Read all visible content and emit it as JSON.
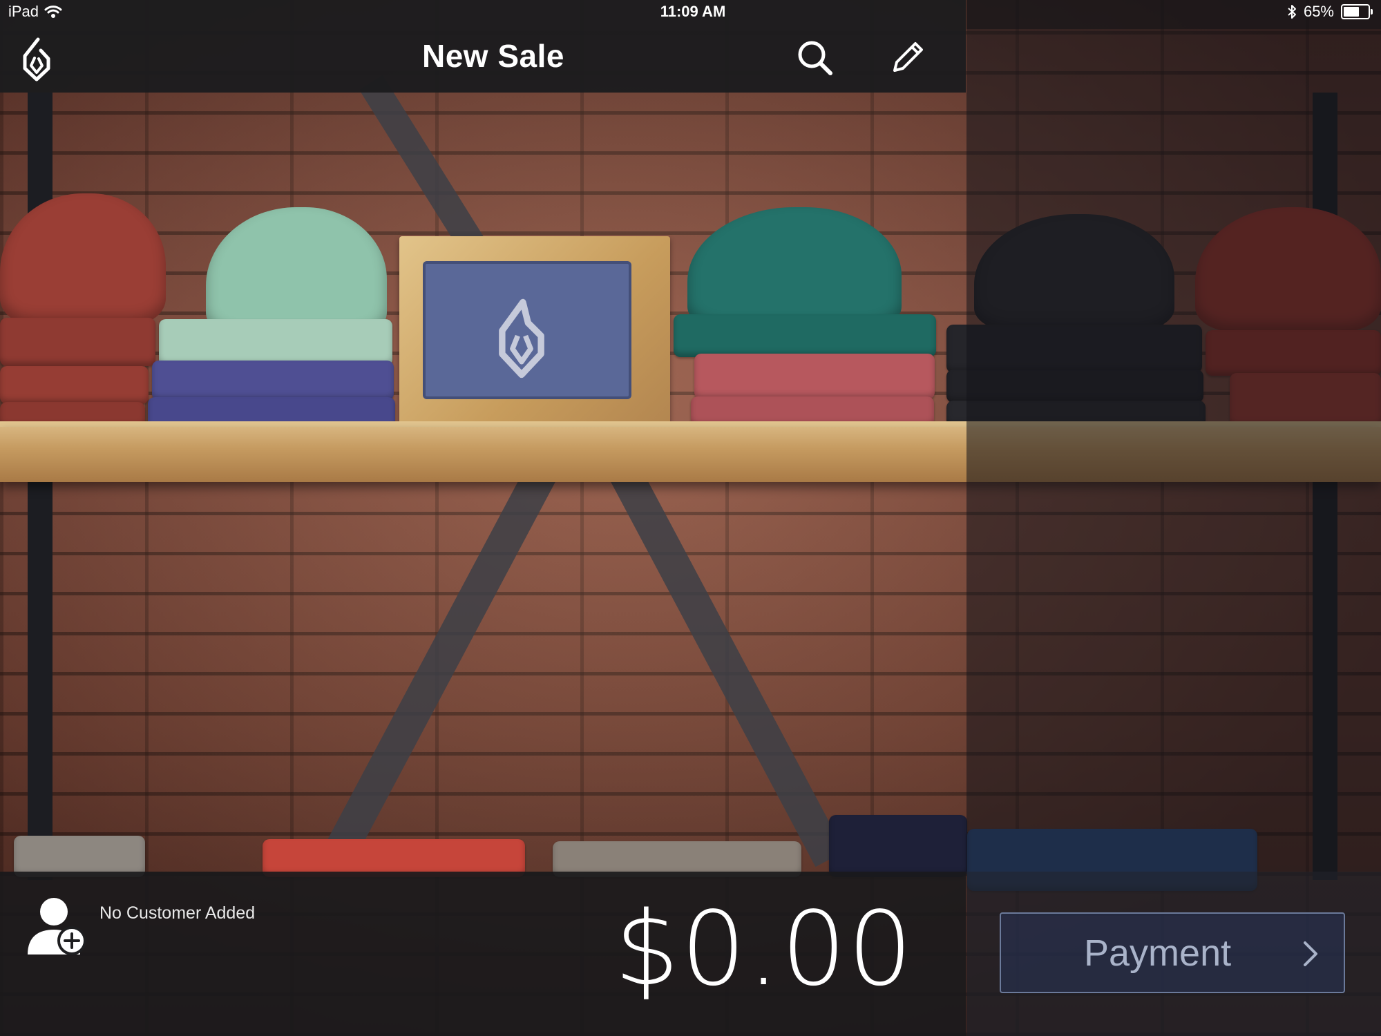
{
  "status_bar": {
    "device": "iPad",
    "time": "11:09 AM",
    "battery_text": "65%",
    "battery_level": 0.65
  },
  "nav": {
    "title": "New Sale",
    "icons": {
      "logo": "lightspeed-flame-logo",
      "search": "search-icon",
      "edit": "pencil-icon"
    }
  },
  "sale": {
    "customer_label": "No Customer Added",
    "customer_icon": "add-customer-icon",
    "total": "$0.00",
    "payment_label": "Payment",
    "payment_icon": "chevron-right-icon"
  },
  "colors": {
    "bar_background": "#1c1c1e",
    "text_primary": "#ffffff",
    "payment_border": "#6b7a9a",
    "payment_text": "#a9b3c9"
  }
}
